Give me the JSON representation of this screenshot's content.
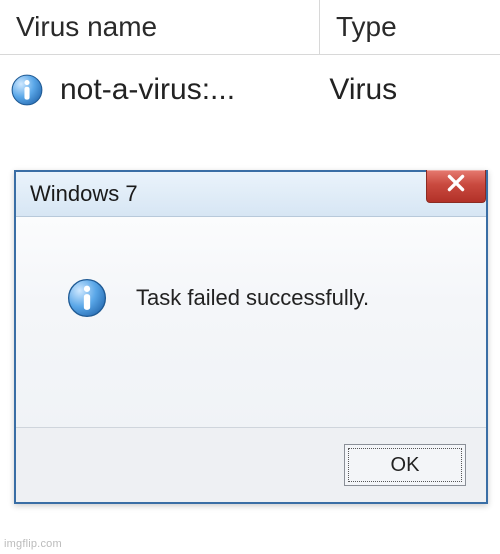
{
  "table": {
    "headers": {
      "name": "Virus name",
      "type": "Type"
    },
    "row": {
      "name": "not-a-virus:...",
      "type": "Virus"
    }
  },
  "dialog": {
    "title": "Windows 7",
    "message": "Task failed successfully.",
    "ok_label": "OK"
  },
  "watermark": "imgflip.com"
}
